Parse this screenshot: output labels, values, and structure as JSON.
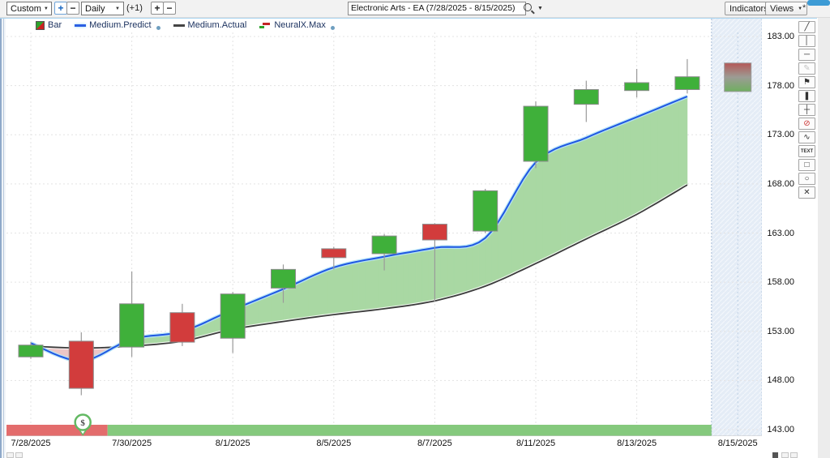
{
  "window": {
    "star": "*"
  },
  "toolbar": {
    "range_select": "Custom",
    "zoom_in": "+",
    "zoom_out": "−",
    "period_select": "Daily",
    "offset_label": "(+1)",
    "bar_plus": "+",
    "bar_minus": "−",
    "symbol_title": "Electronic Arts - EA (7/28/2025 - 8/15/2025)",
    "indicators_button": "Indicators",
    "views_button": "Views"
  },
  "legend": {
    "items": [
      {
        "label": "Bar",
        "swatch": "bar",
        "dot": false
      },
      {
        "label": "Medium.Predict",
        "swatch": "predict",
        "dot": true
      },
      {
        "label": "Medium.Actual",
        "swatch": "actual",
        "dot": false
      },
      {
        "label": "NeuralX.Max",
        "swatch": "neural",
        "dot": true
      }
    ]
  },
  "side_tools": [
    {
      "name": "trendline-tool",
      "glyph": "╱"
    },
    {
      "name": "vertical-line-tool",
      "glyph": "│"
    },
    {
      "name": "horizontal-line-tool",
      "glyph": "─"
    },
    {
      "name": "pencil-tool",
      "glyph": "✎",
      "disabled": true
    },
    {
      "name": "flag-pointer-tool",
      "glyph": "⚑"
    },
    {
      "name": "candle-marker-tool",
      "glyph": "❚"
    },
    {
      "name": "crosshair-tool",
      "glyph": "┼"
    },
    {
      "name": "no-entry-tool",
      "glyph": "⊘",
      "accent": "red"
    },
    {
      "name": "wave-tool",
      "glyph": "∿"
    },
    {
      "name": "text-tool",
      "glyph": "TEXT",
      "text": true
    },
    {
      "name": "rectangle-tool",
      "glyph": "□"
    },
    {
      "name": "ellipse-tool",
      "glyph": "○"
    },
    {
      "name": "delete-tool",
      "glyph": "✕"
    }
  ],
  "chart_data": {
    "type": "candlestick",
    "title": "Electronic Arts - EA",
    "date_range": "7/28/2025 - 8/15/2025",
    "y_ticks": [
      183,
      178,
      173,
      168,
      163,
      158,
      153,
      148,
      143
    ],
    "y_tick_decimals": 2,
    "x_labels": [
      {
        "index": 0,
        "label": "7/28/2025"
      },
      {
        "index": 2,
        "label": "7/30/2025"
      },
      {
        "index": 4,
        "label": "8/1/2025"
      },
      {
        "index": 6,
        "label": "8/5/2025"
      },
      {
        "index": 8,
        "label": "8/7/2025"
      },
      {
        "index": 10,
        "label": "8/11/2025"
      },
      {
        "index": 12,
        "label": "8/13/2025"
      },
      {
        "index": 14,
        "label": "8/15/2025"
      }
    ],
    "candles": [
      {
        "date": "7/28/2025",
        "open": 150.4,
        "high": 151.9,
        "low": 150.2,
        "close": 151.6,
        "dir": "up"
      },
      {
        "date": "7/29/2025",
        "open": 152.0,
        "high": 152.9,
        "low": 146.5,
        "close": 147.2,
        "dir": "down"
      },
      {
        "date": "7/30/2025",
        "open": 151.4,
        "high": 159.1,
        "low": 150.4,
        "close": 155.8,
        "dir": "up"
      },
      {
        "date": "7/31/2025",
        "open": 154.9,
        "high": 155.8,
        "low": 151.5,
        "close": 151.9,
        "dir": "down"
      },
      {
        "date": "8/1/2025",
        "open": 152.3,
        "high": 157.0,
        "low": 150.8,
        "close": 156.8,
        "dir": "up"
      },
      {
        "date": "8/4/2025",
        "open": 157.4,
        "high": 159.8,
        "low": 155.9,
        "close": 159.3,
        "dir": "up"
      },
      {
        "date": "8/5/2025",
        "open": 161.4,
        "high": 161.6,
        "low": 159.3,
        "close": 160.5,
        "dir": "down"
      },
      {
        "date": "8/6/2025",
        "open": 160.9,
        "high": 162.9,
        "low": 159.2,
        "close": 162.7,
        "dir": "up"
      },
      {
        "date": "8/7/2025",
        "open": 163.9,
        "high": 164.0,
        "low": 156.0,
        "close": 162.3,
        "dir": "down"
      },
      {
        "date": "8/8/2025",
        "open": 163.2,
        "high": 167.5,
        "low": 163.0,
        "close": 167.3,
        "dir": "up"
      },
      {
        "date": "8/11/2025",
        "open": 170.3,
        "high": 176.4,
        "low": 169.6,
        "close": 175.9,
        "dir": "up"
      },
      {
        "date": "8/12/2025",
        "open": 176.1,
        "high": 178.5,
        "low": 174.3,
        "close": 177.6,
        "dir": "up"
      },
      {
        "date": "8/13/2025",
        "open": 177.5,
        "high": 179.7,
        "low": 176.8,
        "close": 178.3,
        "dir": "up"
      },
      {
        "date": "8/14/2025",
        "open": 177.6,
        "high": 180.7,
        "low": 177.2,
        "close": 178.9,
        "dir": "up"
      }
    ],
    "forecast_candle": {
      "date": "8/15/2025",
      "top": 180.3,
      "bottom": 177.4,
      "style": "red-gray-green-gradient"
    },
    "series": [
      {
        "name": "Medium.Predict",
        "color": "#1f57e2",
        "values": [
          151.8,
          150.0,
          152.2,
          153.0,
          155.2,
          157.3,
          159.5,
          160.6,
          161.5,
          162.5,
          170.2,
          172.7,
          174.8,
          176.9
        ]
      },
      {
        "name": "Medium.Actual",
        "color": "#3c3c3c",
        "values": [
          151.5,
          151.3,
          151.5,
          152.0,
          153.2,
          154.0,
          154.7,
          155.3,
          156.1,
          157.6,
          159.9,
          162.4,
          164.9,
          167.9
        ]
      }
    ],
    "band": {
      "positive_color": "#a9d8a3",
      "negative_color": "#ecc6c6"
    },
    "signal_strip": {
      "bearish_color": "#e36c6c",
      "bullish_color": "#85c97d",
      "bearish_until_index": 1.52,
      "marker_index": 1.03,
      "marker_glyph": "$"
    },
    "forecast_zone": {
      "from_index": 13.48,
      "to_index": 14.48,
      "fill": "#e4ecf6"
    },
    "candle_colors": {
      "up": "#3fb03a",
      "down": "#d23c3c",
      "border": "#8b8b8b",
      "wick": "#9a9a9a"
    }
  }
}
